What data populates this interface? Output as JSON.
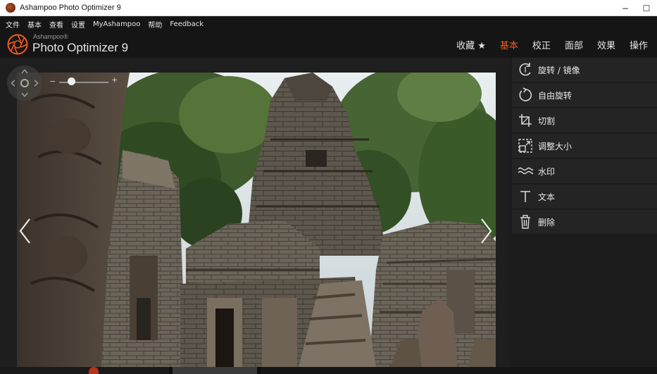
{
  "window": {
    "title": "Ashampoo Photo Optimizer 9",
    "minimize_glyph": "−",
    "maximize_glyph": "☐"
  },
  "menu": [
    "文件",
    "基本",
    "查看",
    "设置",
    "MyAshampoo",
    "帮助",
    "Feedback"
  ],
  "brand": {
    "small": "Ashampoo®",
    "name": "Photo Optimizer 9",
    "logo_icon": "aperture-logo-icon",
    "accent": "#f05a1e"
  },
  "tabs": [
    {
      "label": "收藏 ★",
      "active": false
    },
    {
      "label": "基本",
      "active": true
    },
    {
      "label": "校正",
      "active": false
    },
    {
      "label": "面部",
      "active": false
    },
    {
      "label": "效果",
      "active": false
    },
    {
      "label": "操作",
      "active": false
    }
  ],
  "viewer": {
    "zoom_minus": "−",
    "zoom_plus": "+",
    "zoom_level": 0.25
  },
  "panel": {
    "items": [
      {
        "label": "旋转 / 镜像",
        "icon": "rotate-mirror-icon"
      },
      {
        "label": "自由旋转",
        "icon": "free-rotate-icon"
      },
      {
        "label": "切割",
        "icon": "crop-icon"
      },
      {
        "label": "调整大小",
        "icon": "resize-icon"
      },
      {
        "label": "水印",
        "icon": "watermark-icon"
      },
      {
        "label": "文本",
        "icon": "text-icon"
      },
      {
        "label": "删除",
        "icon": "trash-icon"
      }
    ]
  }
}
